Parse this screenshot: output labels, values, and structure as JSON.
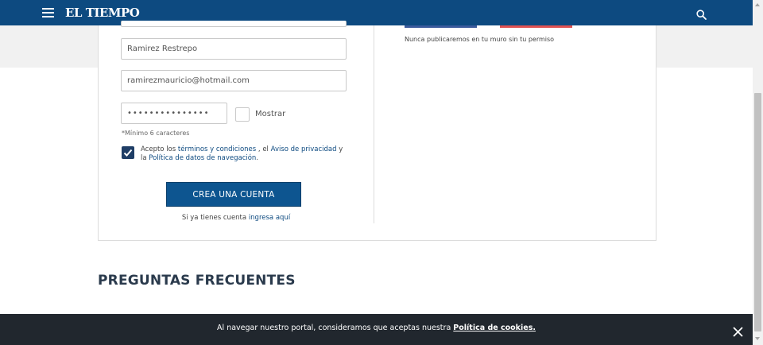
{
  "header": {
    "logo": "EL TIEMPO",
    "menu_icon": "hamburger-menu-icon",
    "search_icon": "search-icon",
    "color": "#0d4a80"
  },
  "form": {
    "lastname_value": "Ramirez Restrepo",
    "email_value": "ramirezmauricio@hotmail.com",
    "password_value": "•••••••••••••••",
    "show_label": "Mostrar",
    "hint": "*Mínimo 6 caracteres",
    "terms": {
      "prefix": "Acepto los ",
      "terms_link": "términos y condiciones",
      "middle": " , el ",
      "privacy_link": "Aviso de privacidad",
      "and": " y la ",
      "policy_link": "Política de datos de navegación",
      "suffix": "."
    },
    "create_button": "CREA UNA CUENTA",
    "login_prefix": "Si ya tienes cuenta ",
    "login_link": "ingresa aquí"
  },
  "social": {
    "note": "Nunca publicaremos en tu muro sin tu permiso"
  },
  "faq": {
    "title": "PREGUNTAS FRECUENTES"
  },
  "cookie": {
    "text": "Al navegar nuestro portal, consideramos que aceptas nuestra ",
    "link": "Política de cookies.",
    "close_icon": "close-icon"
  }
}
